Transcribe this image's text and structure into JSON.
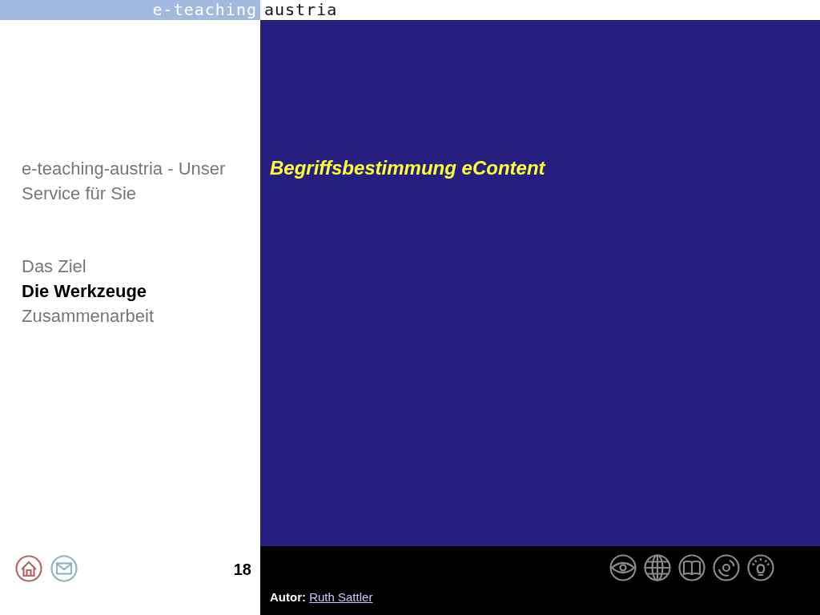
{
  "header": {
    "logo_left": "e-teaching",
    "logo_right": "austria"
  },
  "sidebar": {
    "title": "e-teaching-austria - Unser Service für Sie",
    "items": [
      {
        "label": "Das Ziel",
        "selected": false
      },
      {
        "label": "Die Werkzeuge",
        "selected": true
      },
      {
        "label": "Zusammenarbeit",
        "selected": false
      }
    ],
    "page_number": "18"
  },
  "slide": {
    "title": "Begriffsbestimmung eContent"
  },
  "footer": {
    "author_label": "Autor:",
    "author_name": "Ruth Sattler"
  }
}
